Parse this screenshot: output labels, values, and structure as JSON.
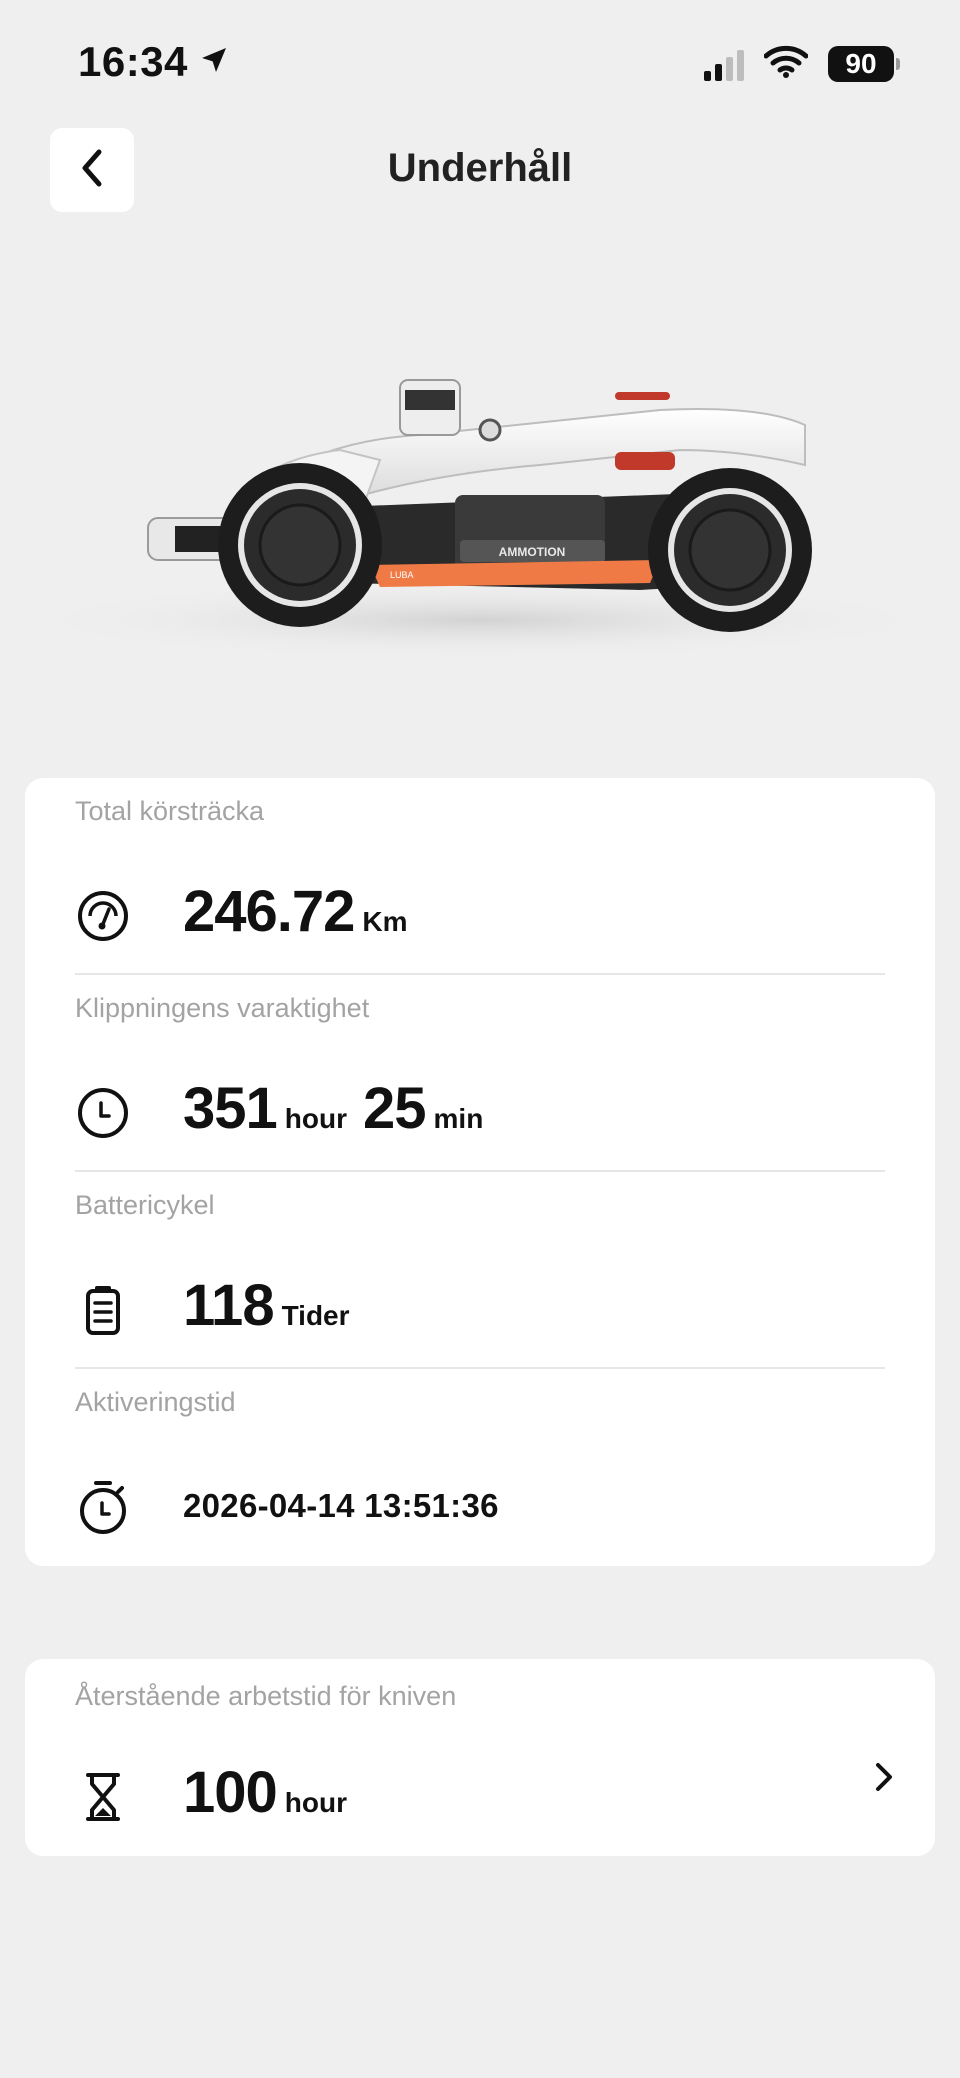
{
  "status_bar": {
    "time": "16:34",
    "battery": "90"
  },
  "header": {
    "title": "Underhåll"
  },
  "stats": {
    "distance": {
      "label": "Total körsträcka",
      "value": "246.72",
      "unit": "Km"
    },
    "duration": {
      "label": "Klippningens varaktighet",
      "hours": "351",
      "hours_unit": "hour",
      "minutes": "25",
      "minutes_unit": "min"
    },
    "battery_cycles": {
      "label": "Battericykel",
      "value": "118",
      "unit": "Tider"
    },
    "activation": {
      "label": "Aktiveringstid",
      "value": "2026-04-14 13:51:36"
    }
  },
  "blade": {
    "label": "Återstående arbetstid för kniven",
    "value": "100",
    "unit": "hour"
  },
  "product": {
    "brand": "AMMOTION",
    "model": "LUBA"
  },
  "colors": {
    "accent_orange": "#f07a45",
    "background": "#efefef"
  },
  "icons": [
    "location-arrow-icon",
    "cellular-signal-icon",
    "wifi-icon",
    "battery-icon",
    "back-chevron-icon",
    "speedometer-icon",
    "clock-icon",
    "battery-cycle-icon",
    "stopwatch-icon",
    "hourglass-icon",
    "chevron-right-icon"
  ]
}
